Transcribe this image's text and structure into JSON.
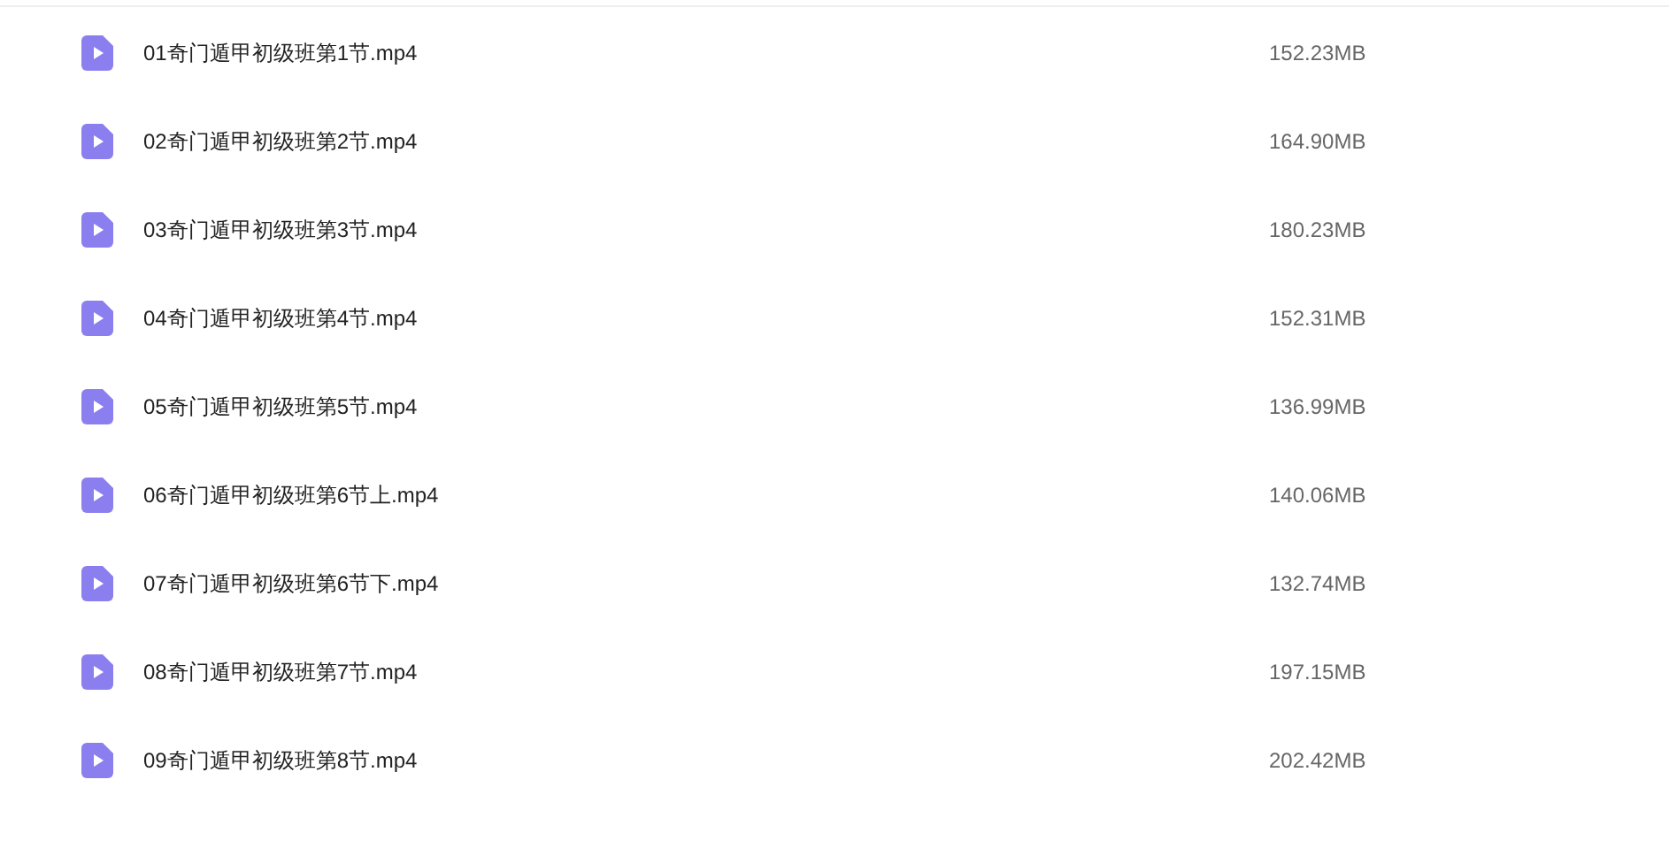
{
  "files": [
    {
      "name": "01奇门遁甲初级班第1节.mp4",
      "size": "152.23MB"
    },
    {
      "name": "02奇门遁甲初级班第2节.mp4",
      "size": "164.90MB"
    },
    {
      "name": "03奇门遁甲初级班第3节.mp4",
      "size": "180.23MB"
    },
    {
      "name": "04奇门遁甲初级班第4节.mp4",
      "size": "152.31MB"
    },
    {
      "name": "05奇门遁甲初级班第5节.mp4",
      "size": "136.99MB"
    },
    {
      "name": "06奇门遁甲初级班第6节上.mp4",
      "size": "140.06MB"
    },
    {
      "name": "07奇门遁甲初级班第6节下.mp4",
      "size": "132.74MB"
    },
    {
      "name": "08奇门遁甲初级班第7节.mp4",
      "size": "197.15MB"
    },
    {
      "name": "09奇门遁甲初级班第8节.mp4",
      "size": "202.42MB"
    }
  ]
}
